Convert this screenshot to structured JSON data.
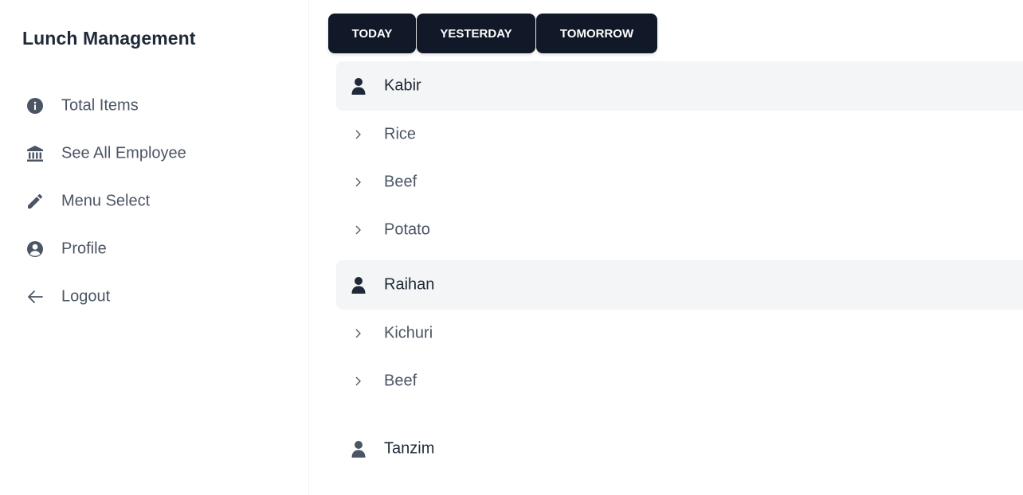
{
  "app": {
    "title": "Lunch Management"
  },
  "sidebar": {
    "items": [
      {
        "label": "Total Items",
        "icon": "info-circle-icon"
      },
      {
        "label": "See All Employee",
        "icon": "bank-icon"
      },
      {
        "label": "Menu Select",
        "icon": "pencil-icon"
      },
      {
        "label": "Profile",
        "icon": "user-circle-icon"
      },
      {
        "label": "Logout",
        "icon": "arrow-left-icon"
      }
    ]
  },
  "tabs": [
    {
      "label": "TODAY"
    },
    {
      "label": "YESTERDAY"
    },
    {
      "label": "TOMORROW"
    }
  ],
  "employees": [
    {
      "name": "Kabir",
      "items": [
        "Rice",
        "Beef",
        "Potato"
      ]
    },
    {
      "name": "Raihan",
      "items": [
        "Kichuri",
        "Beef"
      ]
    },
    {
      "name": "Tanzim",
      "items": []
    }
  ],
  "colors": {
    "tab_bg": "#111827",
    "row_highlight": "#f4f5f7",
    "icon": "#4b5563",
    "text_dark": "#1f2937"
  }
}
